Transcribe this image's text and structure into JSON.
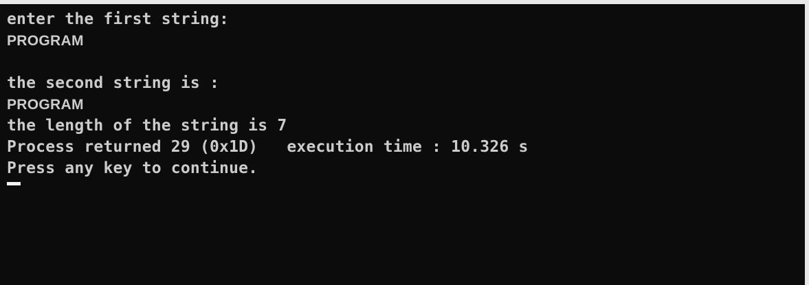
{
  "console": {
    "lines": [
      "enter the first string:",
      "PROGRAM",
      "",
      "the second string is :",
      "PROGRAM",
      "the length of the string is 7",
      "Process returned 29 (0x1D)   execution time : 10.326 s",
      "Press any key to continue."
    ]
  }
}
